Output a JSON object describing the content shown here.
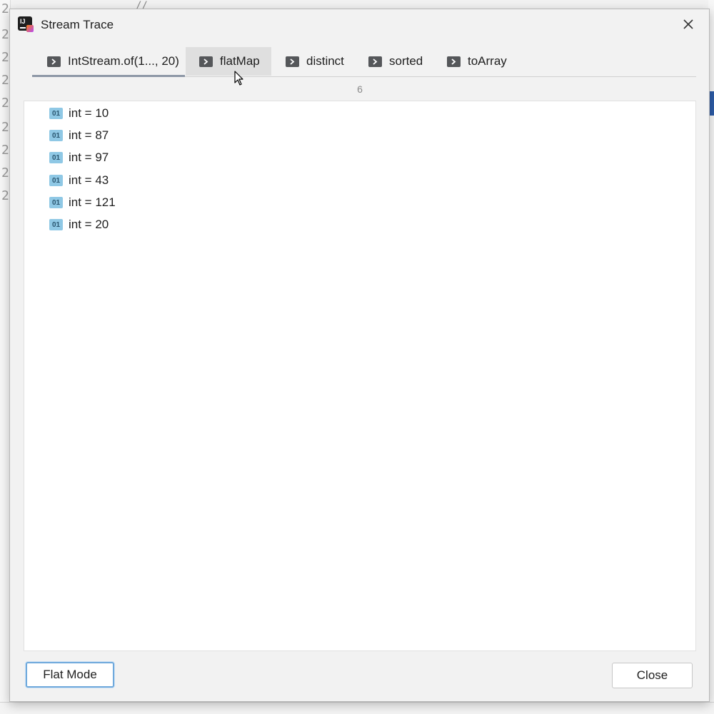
{
  "dialog": {
    "title": "Stream Trace",
    "close_glyph": "✕"
  },
  "tabs": [
    {
      "label": "IntStream.of(1..., 20)",
      "icon": "step-arrow-icon",
      "state": "active"
    },
    {
      "label": "flatMap",
      "icon": "step-arrow-icon",
      "state": "hover"
    },
    {
      "label": "distinct",
      "icon": "step-arrow-icon",
      "state": "normal"
    },
    {
      "label": "sorted",
      "icon": "step-arrow-icon",
      "state": "normal"
    },
    {
      "label": "toArray",
      "icon": "step-arrow-icon",
      "state": "normal"
    }
  ],
  "element_count": "6",
  "values": [
    {
      "icon_text": "01",
      "text": "int = 10"
    },
    {
      "icon_text": "01",
      "text": "int = 87"
    },
    {
      "icon_text": "01",
      "text": "int = 97"
    },
    {
      "icon_text": "01",
      "text": "int = 43"
    },
    {
      "icon_text": "01",
      "text": "int = 121"
    },
    {
      "icon_text": "01",
      "text": "int = 20"
    }
  ],
  "buttons": {
    "flat_mode": "Flat Mode",
    "close": "Close"
  },
  "background": {
    "code_snippet": "//",
    "line_numbers": [
      "2",
      "2",
      "2",
      "2",
      "2",
      "2",
      "2",
      "2",
      "2"
    ]
  },
  "colors": {
    "active_tab_underline": "#8d97a6",
    "value_icon": "#8fc8e5",
    "focus_border": "#6fa9dc"
  }
}
